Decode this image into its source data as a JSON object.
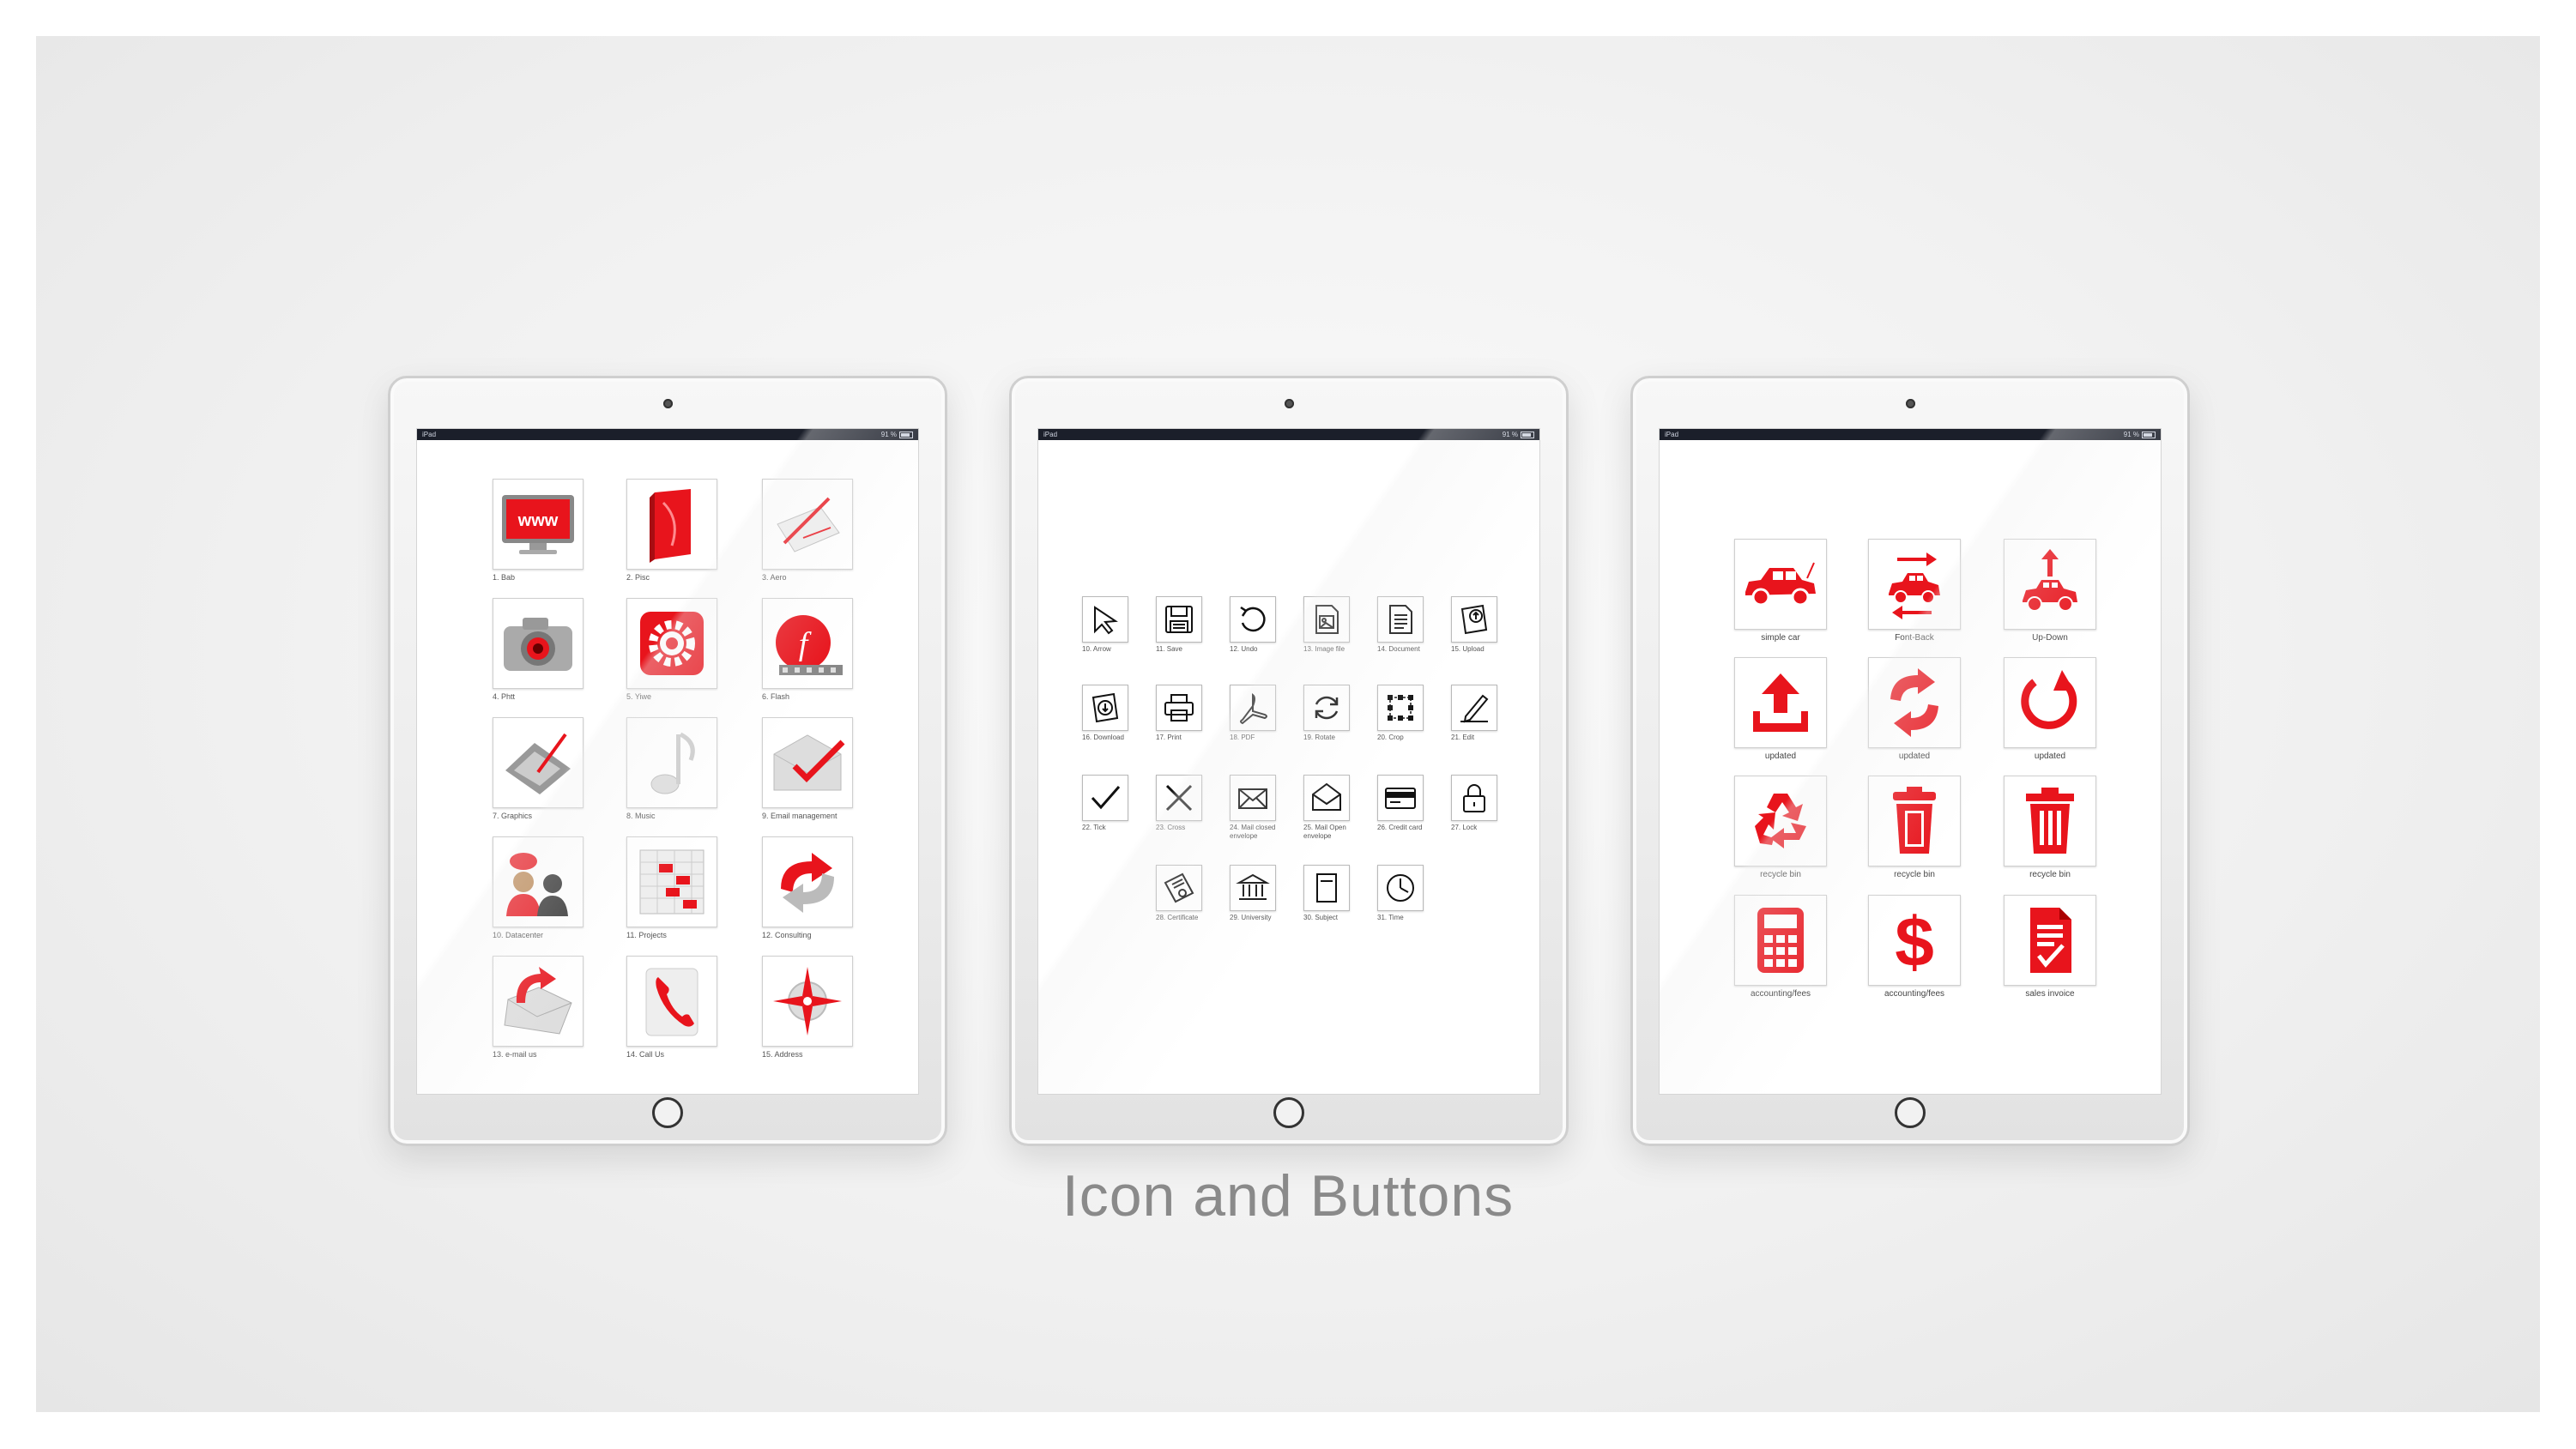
{
  "caption": "Icon and Buttons",
  "accent_color": "#e8141c",
  "status_bar": {
    "device": "iPad",
    "battery": "91 %"
  },
  "tablet1": {
    "items": [
      {
        "label": "1. Bab",
        "icon": "monitor-www-icon"
      },
      {
        "label": "2. Pisc",
        "icon": "red-book-icon"
      },
      {
        "label": "3. Aero",
        "icon": "pen-paper-icon"
      },
      {
        "label": "4. Phtt",
        "icon": "camera-icon"
      },
      {
        "label": "5. Yiwe",
        "icon": "gear-icon"
      },
      {
        "label": "6. Flash",
        "icon": "flash-film-icon"
      },
      {
        "label": "7. Graphics",
        "icon": "drawing-tablet-icon"
      },
      {
        "label": "8. Music",
        "icon": "music-note-icon"
      },
      {
        "label": "9. Email management",
        "icon": "email-check-icon"
      },
      {
        "label": "10. Datacenter",
        "icon": "people-chat-icon"
      },
      {
        "label": "11. Projects",
        "icon": "project-chart-icon"
      },
      {
        "label": "12. Consulting",
        "icon": "consulting-arrows-icon"
      },
      {
        "label": "13. e-mail us",
        "icon": "envelope-arrow-icon"
      },
      {
        "label": "14. Call Us",
        "icon": "phone-icon"
      },
      {
        "label": "15. Address",
        "icon": "compass-icon"
      }
    ]
  },
  "tablet2": {
    "items": [
      {
        "label": "10. Arrow",
        "icon": "cursor-arrow-icon"
      },
      {
        "label": "11. Save",
        "icon": "floppy-disk-icon"
      },
      {
        "label": "12. Undo",
        "icon": "undo-icon"
      },
      {
        "label": "13. Image file",
        "icon": "image-file-icon"
      },
      {
        "label": "14. Document",
        "icon": "document-icon"
      },
      {
        "label": "15. Upload",
        "icon": "upload-icon"
      },
      {
        "label": "16. Download",
        "icon": "download-icon"
      },
      {
        "label": "17. Print",
        "icon": "printer-icon"
      },
      {
        "label": "18. PDF",
        "icon": "pdf-icon"
      },
      {
        "label": "19. Rotate",
        "icon": "rotate-icon"
      },
      {
        "label": "20. Crop",
        "icon": "crop-icon"
      },
      {
        "label": "21. Edit",
        "icon": "edit-icon"
      },
      {
        "label": "22. Tick",
        "icon": "tick-icon"
      },
      {
        "label": "23. Cross",
        "icon": "cross-icon"
      },
      {
        "label": "24. Mail closed envelope",
        "icon": "closed-envelope-icon"
      },
      {
        "label": "25. Mail Open envelope",
        "icon": "open-envelope-icon"
      },
      {
        "label": "26. Credit card",
        "icon": "credit-card-icon"
      },
      {
        "label": "27. Lock",
        "icon": "lock-icon"
      },
      {
        "label": "28. Certificate",
        "icon": "certificate-icon"
      },
      {
        "label": "29. University",
        "icon": "university-icon"
      },
      {
        "label": "30. Subject",
        "icon": "subject-book-icon"
      },
      {
        "label": "31. Time",
        "icon": "clock-icon"
      }
    ]
  },
  "tablet3": {
    "items": [
      {
        "label": "simple car",
        "icon": "car-icon"
      },
      {
        "label": "Font-Back",
        "icon": "car-front-back-icon"
      },
      {
        "label": "Up-Down",
        "icon": "car-up-down-icon"
      },
      {
        "label": "updated",
        "icon": "upload-tray-icon"
      },
      {
        "label": "updated",
        "icon": "refresh-arrows-icon"
      },
      {
        "label": "updated",
        "icon": "refresh-circle-icon"
      },
      {
        "label": "recycle bin",
        "icon": "recycle-icon"
      },
      {
        "label": "recycle bin",
        "icon": "trash-bin-icon"
      },
      {
        "label": "recycle bin",
        "icon": "trash-can-icon"
      },
      {
        "label": "accounting/fees",
        "icon": "calculator-icon"
      },
      {
        "label": "accounting/fees",
        "icon": "dollar-icon"
      },
      {
        "label": "sales invoice",
        "icon": "invoice-icon"
      }
    ]
  }
}
